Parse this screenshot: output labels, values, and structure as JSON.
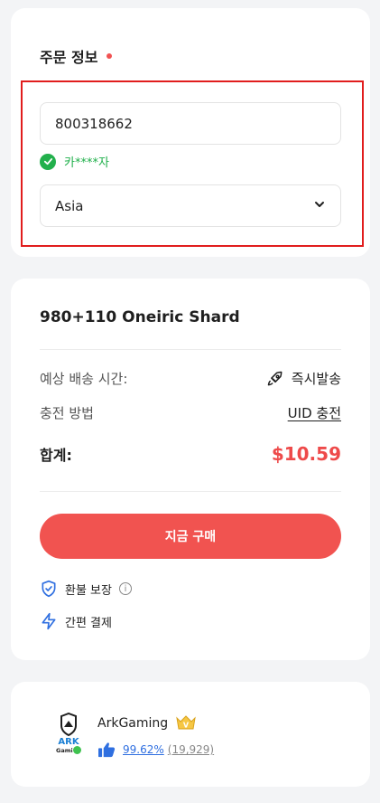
{
  "order_info": {
    "title": "주문 정보",
    "uid_value": "800318662",
    "verified_name": "카****자",
    "server_selected": "Asia"
  },
  "product": {
    "name": "980+110 Oneiric Shard",
    "delivery_label": "예상 배송 시간:",
    "delivery_value": "즉시발송",
    "method_label": "충전 방법",
    "method_value": "UID 충전",
    "total_label": "합계:",
    "total_value": "$10.59",
    "buy_label": "지금 구매",
    "features": [
      {
        "label": "환불 보장",
        "icon": "shield-check-icon"
      },
      {
        "label": "간편 결제",
        "icon": "lightning-icon"
      }
    ]
  },
  "seller": {
    "name": "ArkGaming",
    "logo_text_top": "ARK",
    "logo_text_bottom": "Gaming",
    "vip_label": "V",
    "rating_pct": "99.62%",
    "rating_count": "(19,929)"
  },
  "colors": {
    "accent": "#f15350",
    "success": "#22b04c",
    "link": "#2f6fe0",
    "highlight_border": "#e11d1d"
  }
}
